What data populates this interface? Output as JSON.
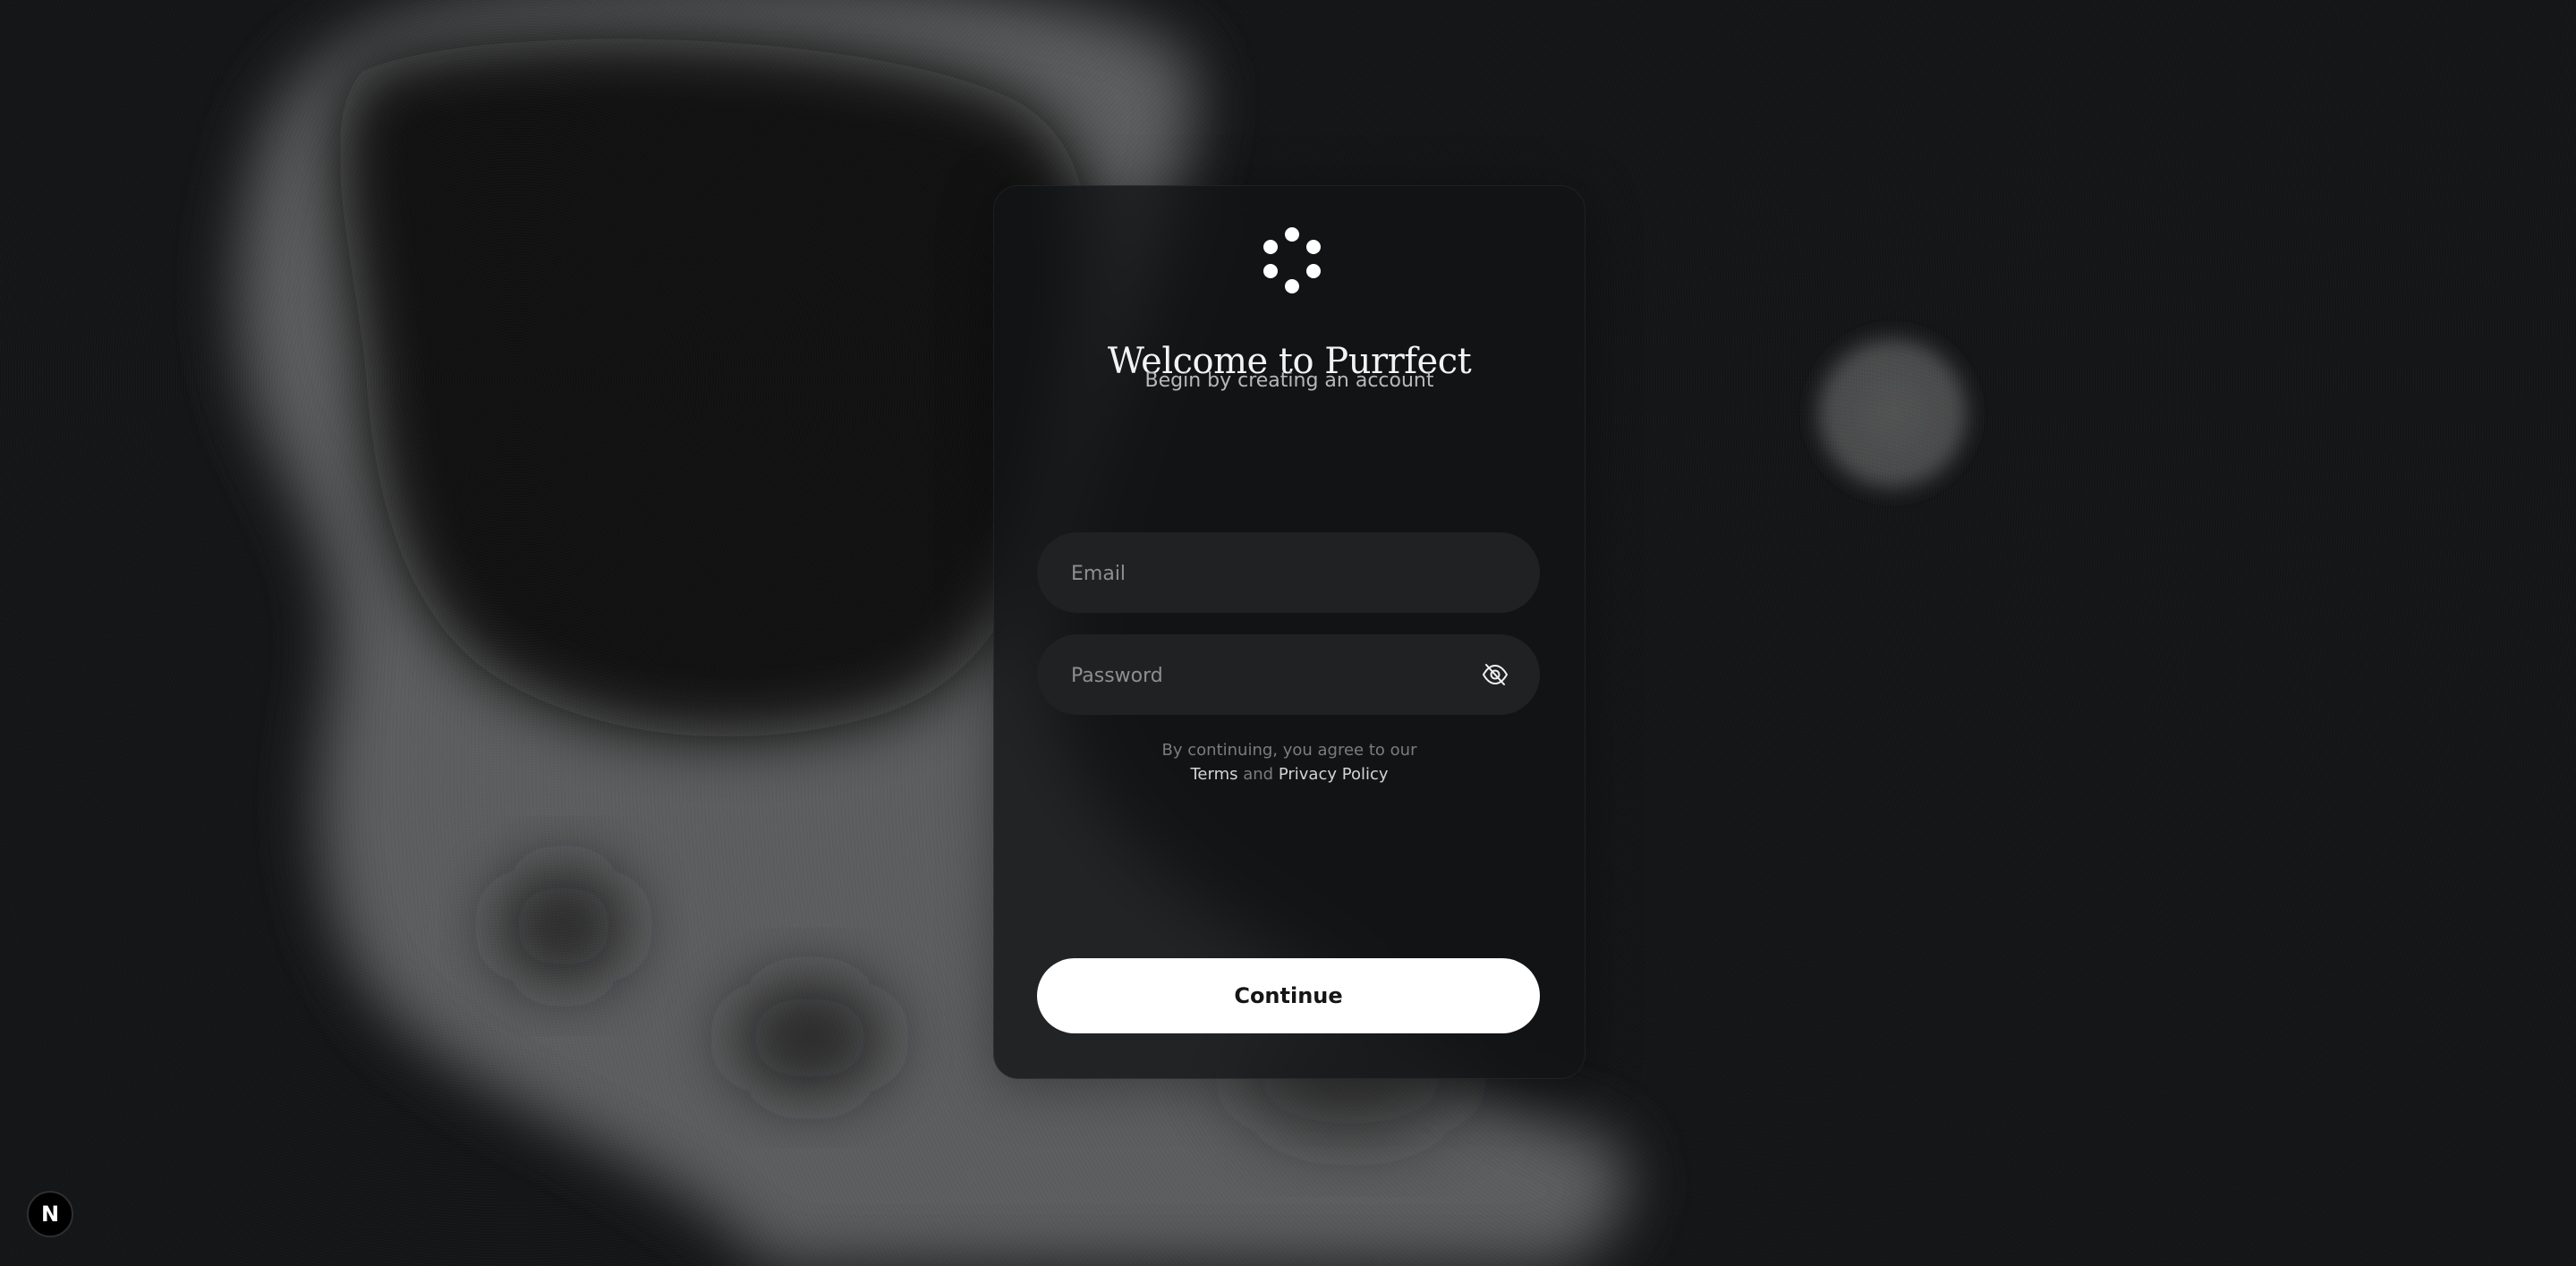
{
  "page": {
    "title": "Welcome to Purrfect",
    "subtitle": "Begin by creating an account"
  },
  "form": {
    "email_placeholder": "Email",
    "email_value": "",
    "password_placeholder": "Password",
    "password_value": "",
    "password_toggle_icon": "eye-off-icon"
  },
  "terms": {
    "prefix": "By continuing, you agree to our",
    "terms_label": "Terms",
    "conjunction": "and",
    "privacy_label": "Privacy Policy"
  },
  "actions": {
    "continue_label": "Continue"
  },
  "badge": {
    "label": "N",
    "icon": "next-logo-icon"
  },
  "colors": {
    "background": "#141516",
    "card": "#121314",
    "field": "#202123",
    "button": "#ffffff",
    "title": "#f3f3f3"
  }
}
